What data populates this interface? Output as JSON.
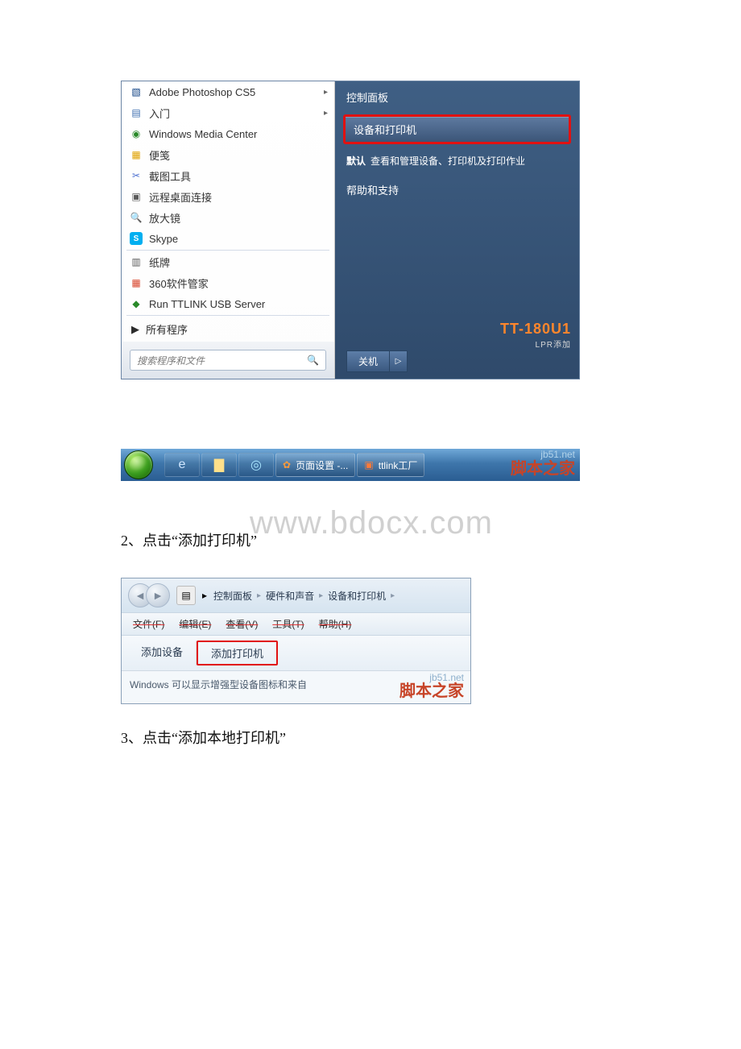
{
  "screenshot1": {
    "left": {
      "items": [
        {
          "label": "Adobe Photoshop CS5",
          "icon": "ps-icon",
          "submenu": true
        },
        {
          "label": "入门",
          "icon": "file-icon",
          "submenu": true
        },
        {
          "label": "Windows Media Center",
          "icon": "wmc-icon"
        },
        {
          "label": "便笺",
          "icon": "note-icon"
        },
        {
          "label": "截图工具",
          "icon": "snip-icon"
        },
        {
          "label": "远程桌面连接",
          "icon": "rdp-icon"
        },
        {
          "label": "放大镜",
          "icon": "magnifier-icon"
        },
        {
          "label": "Skype",
          "icon": "skype-icon"
        },
        {
          "label": "纸牌",
          "icon": "cards-icon",
          "sep_before": true
        },
        {
          "label": "360软件管家",
          "icon": "360-icon"
        },
        {
          "label": "Run TTLINK USB Server",
          "icon": "ttlink-icon"
        }
      ],
      "all_programs": "所有程序",
      "search_placeholder": "搜索程序和文件"
    },
    "right": {
      "control_panel": "控制面板",
      "devices_printers": "设备和打印机",
      "default_label": "默认",
      "default_desc": "查看和管理设备、打印机及打印作业",
      "help_support": "帮助和支持",
      "tt_brand": "TT-180U1",
      "tt_sub": "LPR添加",
      "shutdown": "关机"
    },
    "taskbar": {
      "task1": "页面设置 -...",
      "task2": "ttlink工厂"
    },
    "watermark": {
      "line1": "jb51.net",
      "line2": "脚本之家"
    }
  },
  "step2_text": "2、点击“添加打印机”",
  "big_watermark": "www.bdocx.com",
  "screenshot2": {
    "breadcrumb": {
      "a": "控制面板",
      "b": "硬件和声音",
      "c": "设备和打印机"
    },
    "menu": {
      "file": "文件(F)",
      "edit": "编辑(E)",
      "view": "查看(V)",
      "tools": "工具(T)",
      "help": "帮助(H)"
    },
    "toolbar": {
      "add_device": "添加设备",
      "add_printer": "添加打印机"
    },
    "infobar": "Windows 可以显示增强型设备图标和来自",
    "watermark": {
      "line1": "jb51.net",
      "line2": "脚本之家"
    }
  },
  "step3_text": "3、点击“添加本地打印机”"
}
